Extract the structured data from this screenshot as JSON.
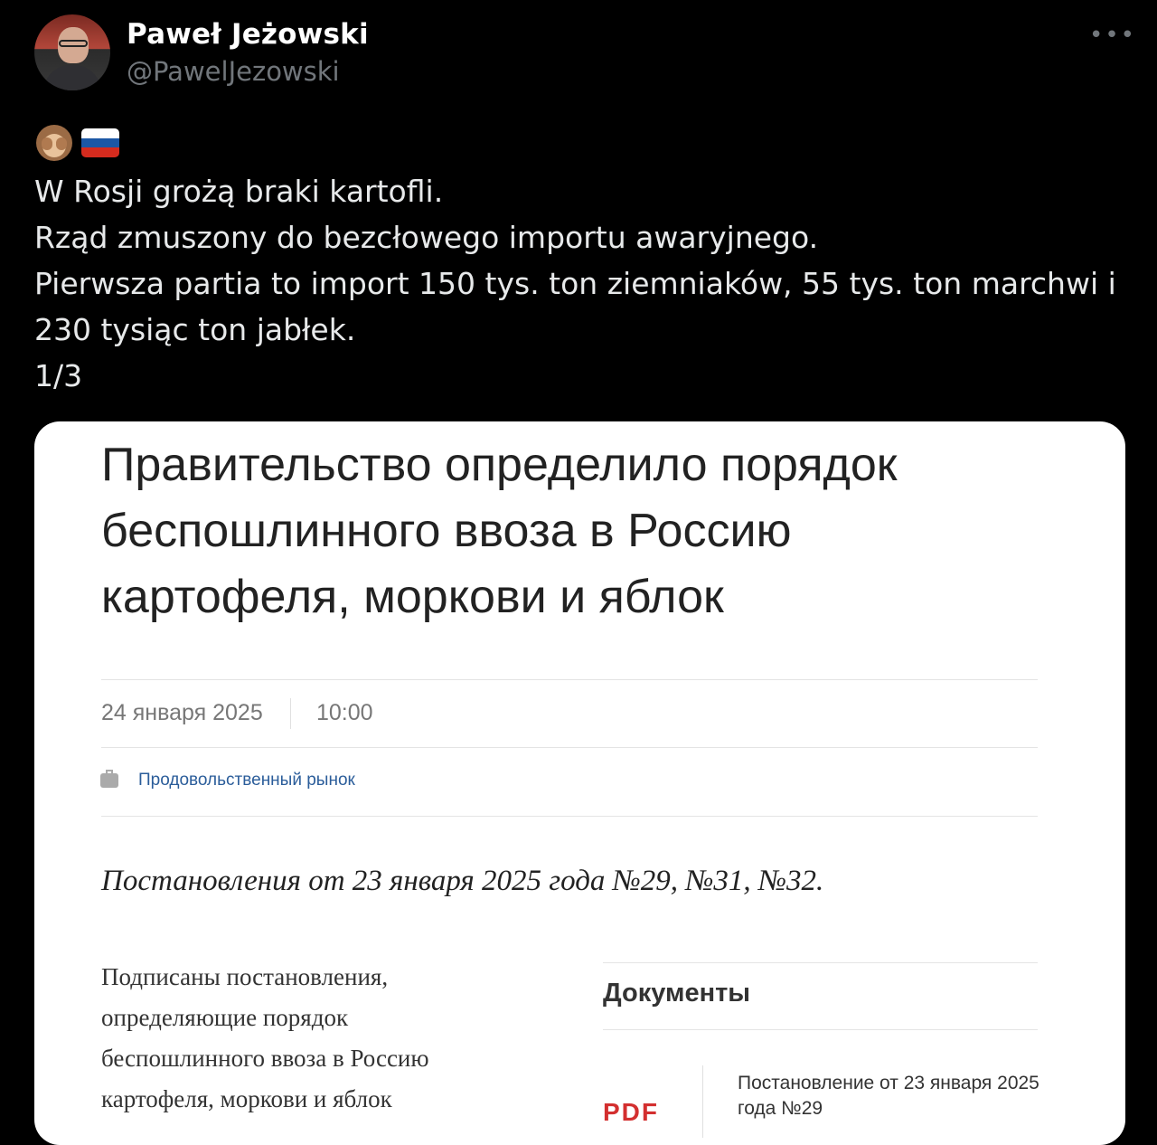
{
  "author": {
    "name": "Paweł Jeżowski",
    "handle": "@PawelJezowski"
  },
  "tweet": {
    "emoji_icons": [
      "see-no-evil-monkey-icon",
      "russia-flag-icon"
    ],
    "lines": [
      "W Rosji grożą braki kartofli.",
      "Rząd zmuszony do bezcłowego importu awaryjnego.",
      "Pierwsza partia to import 150 tys. ton ziemniaków, 55 tys. ton marchwi i 230 tysiąc ton jabłek.",
      "1/3"
    ]
  },
  "card": {
    "headline": "Правительство определило порядок беспошлинного ввоза в Россию картофеля, моркови и яблок",
    "date": "24 января 2025",
    "time": "10:00",
    "category": "Продовольственный рынок",
    "lead": "Постановления от 23 января 2025 года №29, №31, №32.",
    "body": "Подписаны постановления, определяющие порядок беспошлинного ввоза в Россию картофеля, моркови и яблок",
    "documents_title": "Документы",
    "pdf_label": "PDF",
    "document_link": "Постановление от 23 января 2025 года №29"
  },
  "colors": {
    "background": "#000000",
    "text": "#e7e9ea",
    "muted": "#71767b",
    "link": "#2b5d9a",
    "pdf": "#d32f2f"
  }
}
